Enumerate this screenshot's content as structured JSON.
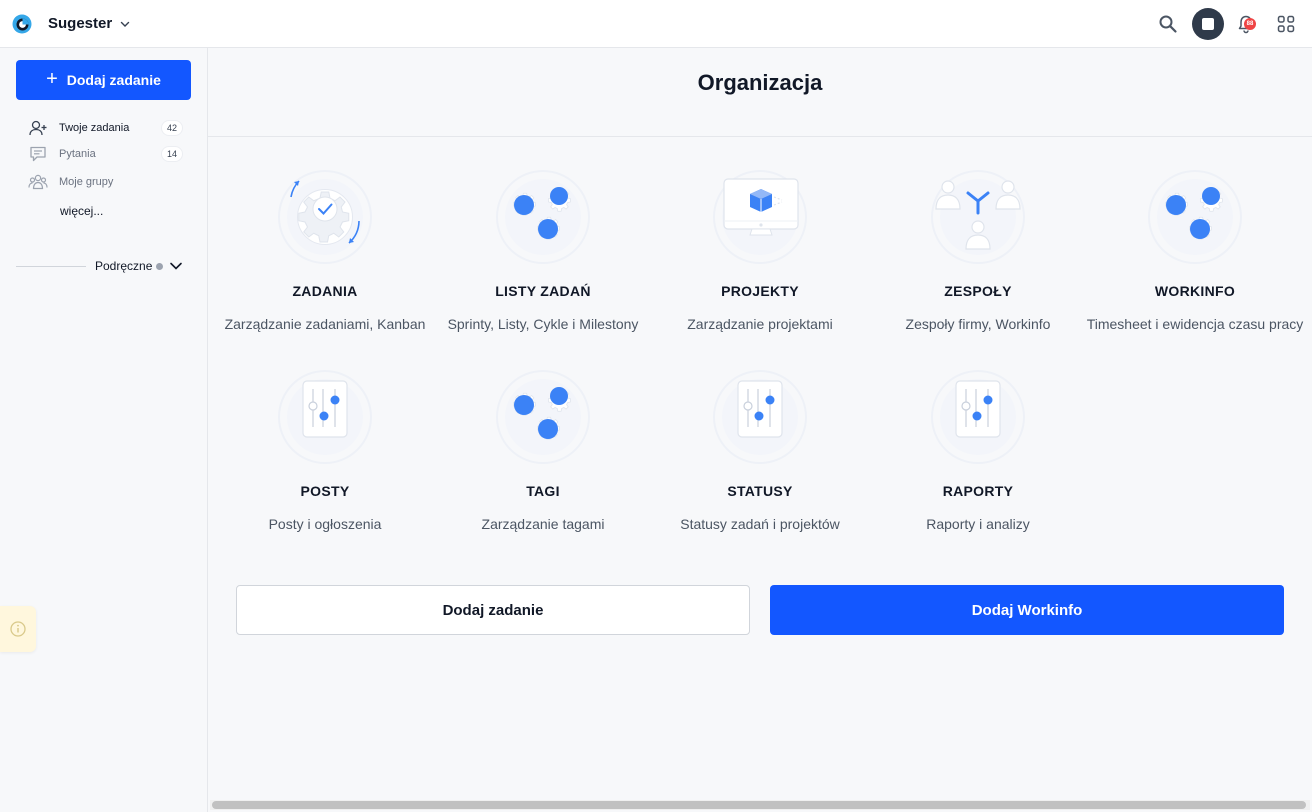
{
  "app": {
    "name": "Sugester"
  },
  "topbar": {
    "notification_count": "88"
  },
  "sidebar": {
    "add_button": "Dodaj zadanie",
    "items": [
      {
        "label": "Twoje zadania",
        "count": "42"
      },
      {
        "label": "Pytania",
        "count": "14"
      },
      {
        "label": "Moje grupy"
      }
    ],
    "more": "więcej...",
    "handy": "Podręczne"
  },
  "main": {
    "title": "Organizacja",
    "tiles": [
      {
        "title": "ZADANIA",
        "desc": "Zarządzanie zadaniami, Kanban",
        "icon": "task-gear-icon"
      },
      {
        "title": "LISTY ZADAŃ",
        "desc": "Sprinty, Listy, Cykle i Milestony",
        "icon": "gears-icon"
      },
      {
        "title": "PROJEKTY",
        "desc": "Zarządzanie projektami",
        "icon": "monitor-cube-icon"
      },
      {
        "title": "ZESPOŁY",
        "desc": "Zespoły firmy, Workinfo",
        "icon": "team-icon"
      },
      {
        "title": "WORKINFO",
        "desc": "Timesheet i ewidencja czasu pracy",
        "icon": "gears-icon"
      },
      {
        "title": "POSTY",
        "desc": "Posty i ogłoszenia",
        "icon": "sliders-icon"
      },
      {
        "title": "TAGI",
        "desc": "Zarządzanie tagami",
        "icon": "gears-icon"
      },
      {
        "title": "STATUSY",
        "desc": "Statusy zadań i projektów",
        "icon": "sliders-icon"
      },
      {
        "title": "RAPORTY",
        "desc": "Raporty i analizy",
        "icon": "sliders-icon"
      }
    ],
    "buttons": {
      "add_task": "Dodaj zadanie",
      "add_workinfo": "Dodaj Workinfo"
    }
  },
  "colors": {
    "accent": "#1357ff",
    "icon_blue": "#3b82f6"
  }
}
